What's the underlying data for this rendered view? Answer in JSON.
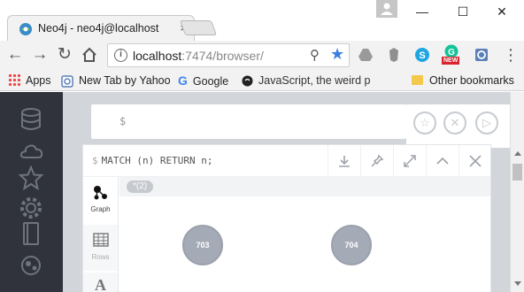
{
  "browser": {
    "tab": {
      "title": "Neo4j - neo4j@localhost",
      "close": "×"
    },
    "window_controls": {
      "minimize": "—",
      "maximize": "☐",
      "close": "✕"
    },
    "omnibox": {
      "host": "localhost",
      "path": ":7474/browser/"
    },
    "extensions": [
      "google-drive-icon",
      "evernote-icon",
      "skype-icon",
      "grammarly-icon",
      "extension-icon"
    ],
    "ext_badge": "NEW",
    "bookmarks": [
      {
        "label": "Apps",
        "icon": "apps-icon"
      },
      {
        "label": "New Tab by Yahoo",
        "icon": "yahoo-icon"
      },
      {
        "label": "Google",
        "icon": "google-icon"
      },
      {
        "label": "JavaScript, the weird p",
        "icon": "github-icon"
      }
    ],
    "other_bookmarks": "Other bookmarks"
  },
  "neo4j": {
    "sidebar_icons": [
      "database-icon",
      "cloud-icon",
      "star-icon",
      "settings-icon",
      "documents-icon",
      "about-icon"
    ],
    "editor": {
      "prompt": "$"
    },
    "editor_buttons": {
      "favorite": "☆",
      "clear": "✕",
      "run": "▷"
    },
    "frame": {
      "dollar": "$",
      "command": "MATCH (n) RETURN n;",
      "views": [
        {
          "label": "Graph",
          "active": true
        },
        {
          "label": "Rows",
          "active": false
        },
        {
          "label": "Text",
          "active": false
        }
      ],
      "legend": "*(2)",
      "nodes": [
        "703",
        "704"
      ]
    }
  },
  "colors": {
    "sidebar": "#30333b",
    "node_fill": "#a5abb6",
    "accent_blue": "#3b7de0"
  }
}
